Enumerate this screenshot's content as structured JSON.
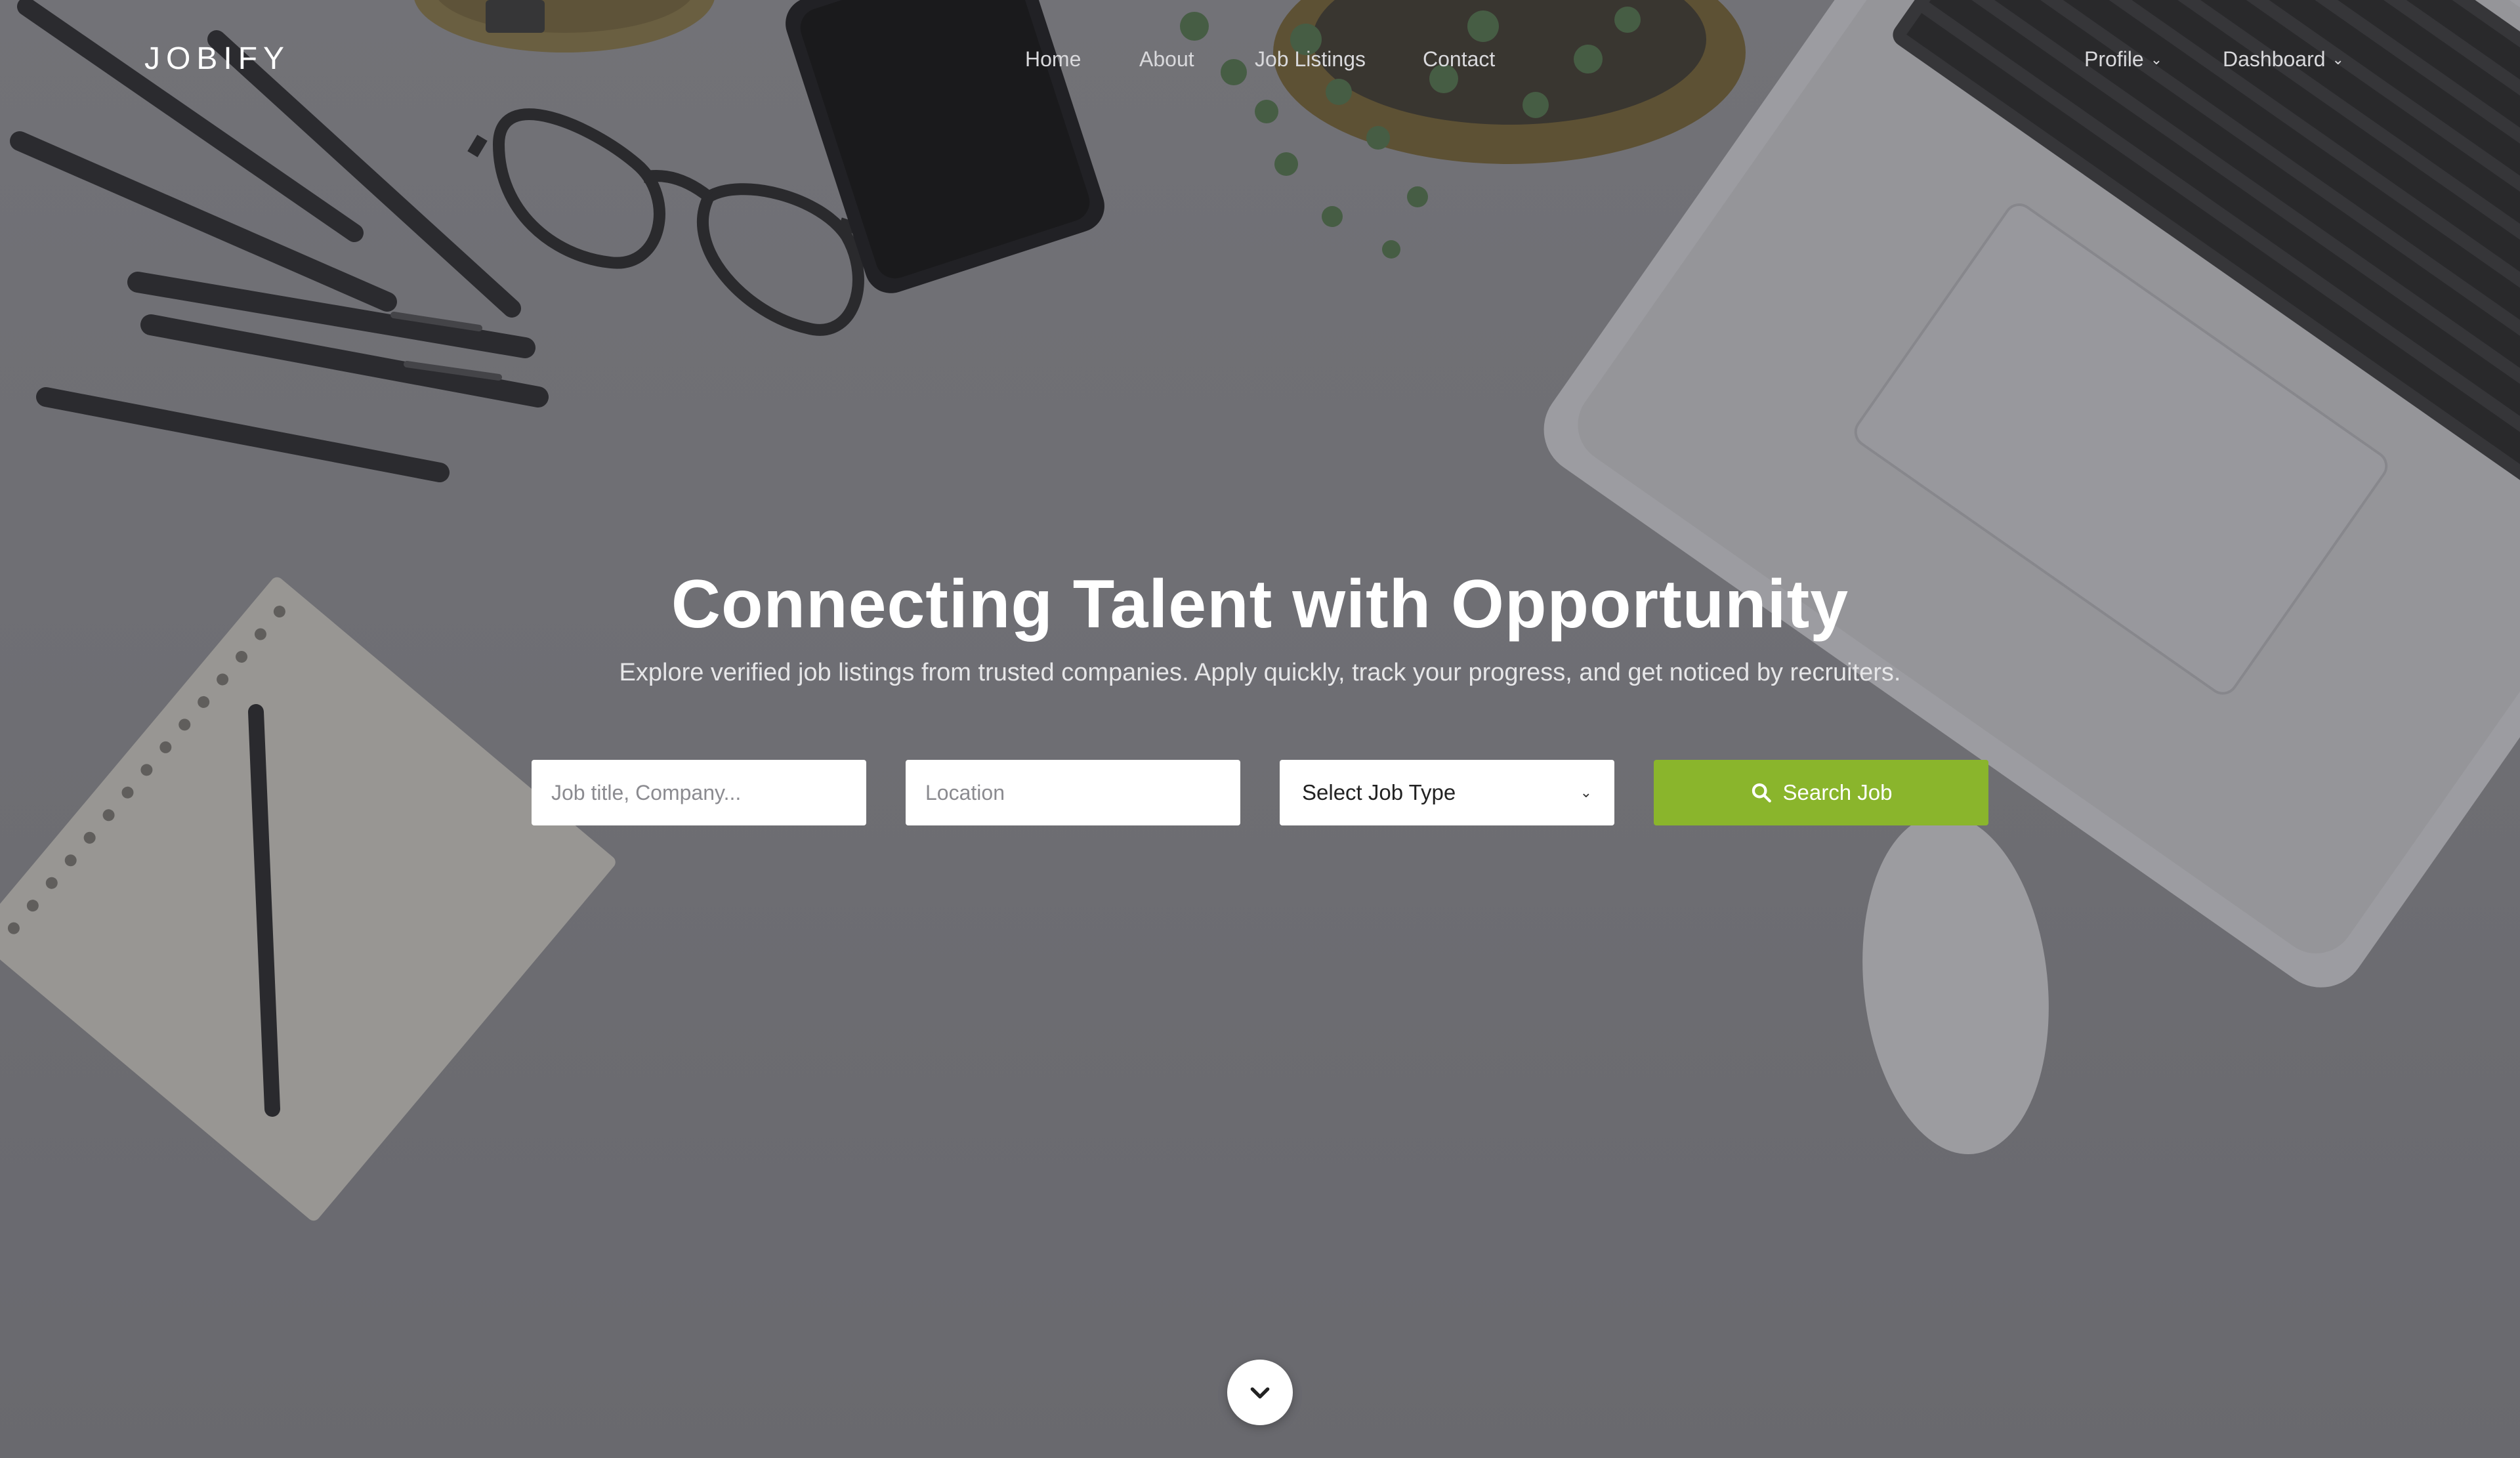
{
  "brand": {
    "logo": "JOBIFY"
  },
  "nav": {
    "items": [
      {
        "label": "Home"
      },
      {
        "label": "About"
      },
      {
        "label": "Job Listings"
      },
      {
        "label": "Contact"
      },
      {
        "label": "Profile",
        "has_dropdown": true
      },
      {
        "label": "Dashboard",
        "has_dropdown": true
      }
    ]
  },
  "hero": {
    "title": "Connecting Talent with Opportunity",
    "subtitle": "Explore verified job listings from trusted companies. Apply quickly, track your progress, and get noticed by recruiters."
  },
  "search": {
    "keyword_placeholder": "Job title, Company...",
    "location_placeholder": "Location",
    "job_type_label": "Select Job Type",
    "button_label": "Search Job",
    "button_icon": "search-icon"
  },
  "scroll": {
    "icon": "chevron-down-icon"
  },
  "colors": {
    "accent": "#8ab52c",
    "overlay": "#6e6e73",
    "text_light": "#ffffff"
  }
}
